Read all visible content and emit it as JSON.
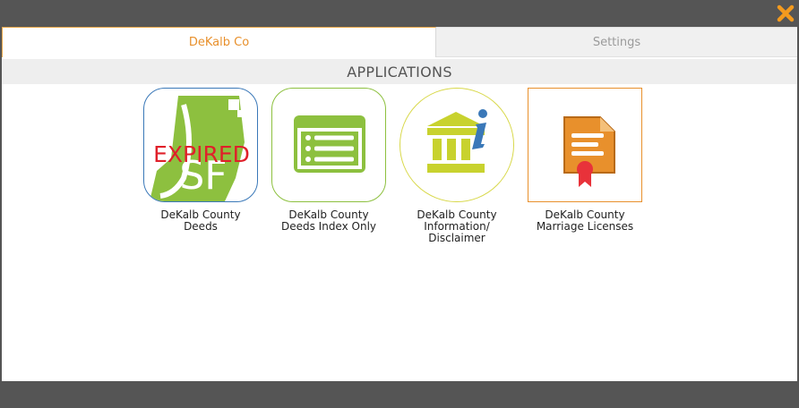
{
  "window": {
    "close_icon": "close-x-icon",
    "close_color": "#f39a1e"
  },
  "tabs": [
    {
      "label": "DeKalb Co",
      "active": true
    },
    {
      "label": "Settings",
      "active": false
    }
  ],
  "section": {
    "title": "APPLICATIONS"
  },
  "apps": [
    {
      "line1": "DeKalb County",
      "line2": "Deeds",
      "line3": "",
      "icon": "expired-sf-icon",
      "icon_text": "EXPIRED",
      "icon_letters": "SF",
      "border_color": "#3a78b8"
    },
    {
      "line1": "DeKalb County",
      "line2": "Deeds Index Only",
      "line3": "",
      "icon": "index-list-icon",
      "border_color": "#8dc03f"
    },
    {
      "line1": "DeKalb County",
      "line2": "Information/",
      "line3": "Disclaimer",
      "icon": "courthouse-info-icon",
      "border_color": "#d8d84a"
    },
    {
      "line1": "DeKalb County",
      "line2": "Marriage Licenses",
      "line3": "",
      "icon": "marriage-certificate-icon",
      "border_color": "#e8902c"
    }
  ]
}
